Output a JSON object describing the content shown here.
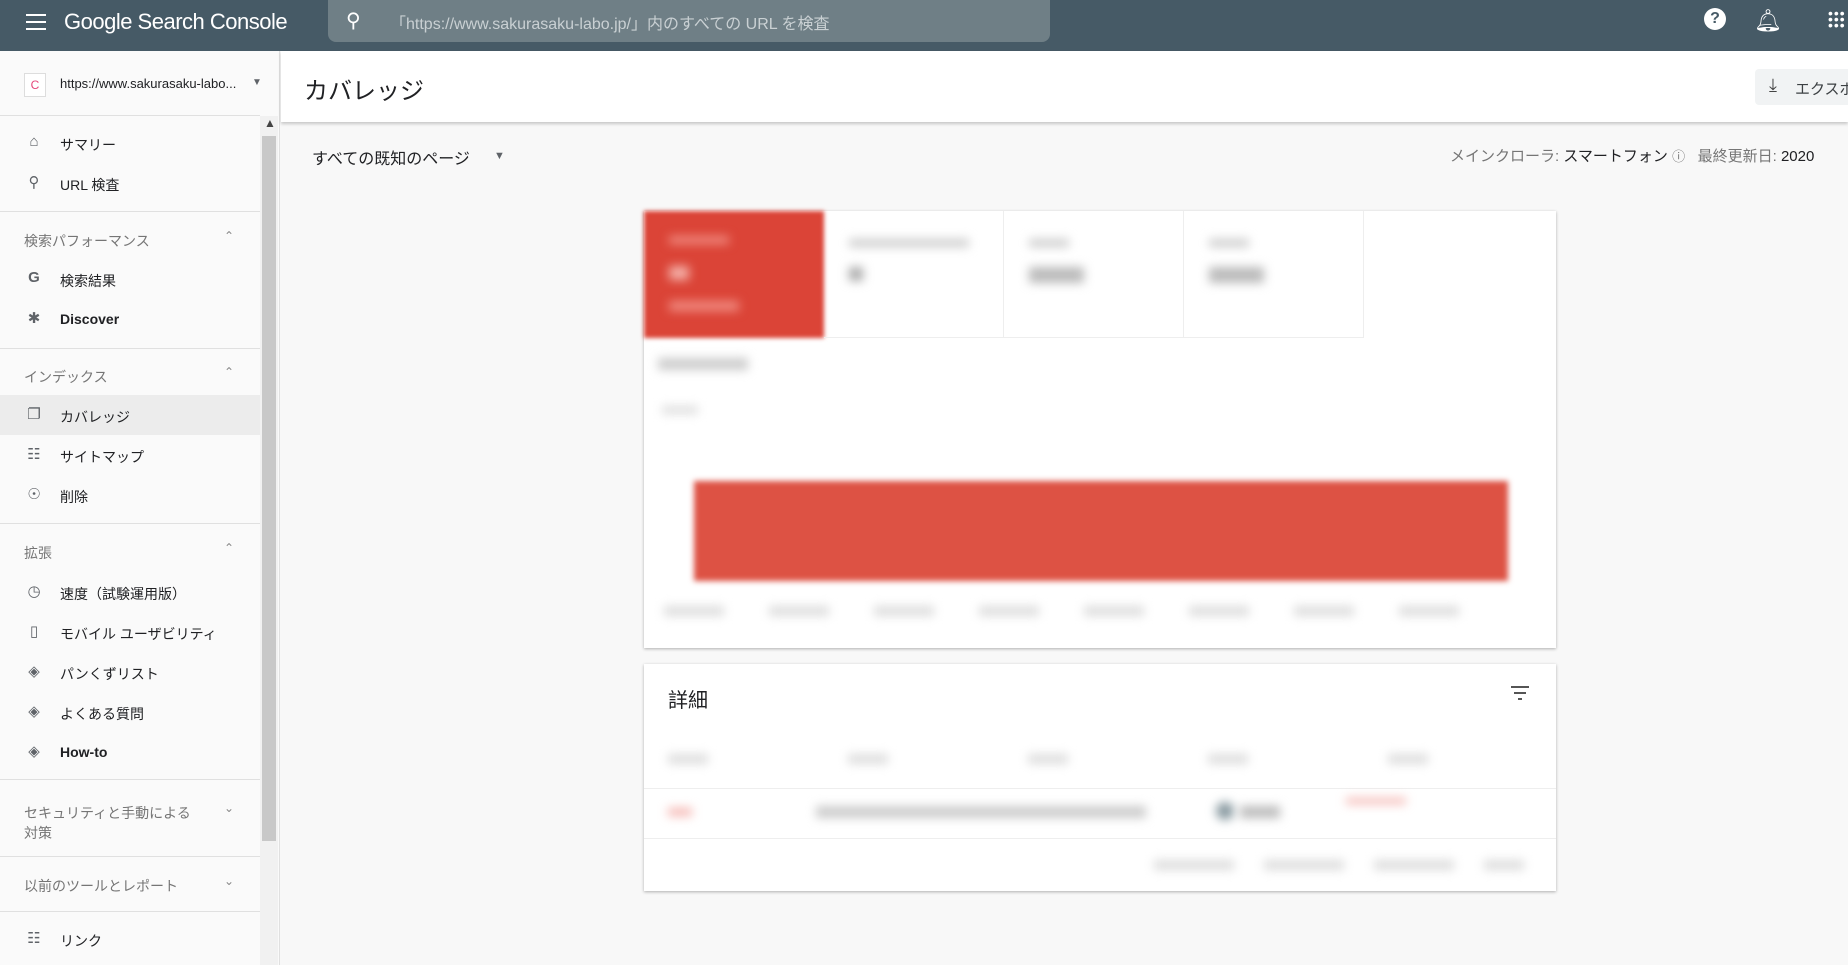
{
  "header": {
    "app_title": "Google Search Console",
    "search_placeholder": "「https://www.sakurasaku-labo.jp/」内のすべての URL を検査",
    "icons": [
      "menu-icon",
      "search-icon",
      "help-icon",
      "bell-icon",
      "apps-icon"
    ],
    "bg_color": "#465a66"
  },
  "property": {
    "url": "https://www.sakurasaku-labo..."
  },
  "sidebar": {
    "items": [
      {
        "label": "サマリー",
        "icon": "home-icon"
      },
      {
        "label": "URL 検査",
        "icon": "search-icon"
      }
    ],
    "sections": [
      {
        "title": "検索パフォーマンス",
        "expanded": true,
        "items": [
          {
            "label": "検索結果",
            "icon": "google-g-icon"
          },
          {
            "label": "Discover",
            "icon": "asterisk-icon"
          }
        ]
      },
      {
        "title": "インデックス",
        "expanded": true,
        "items": [
          {
            "label": "カバレッジ",
            "icon": "copy-icon",
            "selected": true
          },
          {
            "label": "サイトマップ",
            "icon": "sitemap-icon"
          },
          {
            "label": "削除",
            "icon": "eye-off-icon"
          }
        ]
      },
      {
        "title": "拡張",
        "expanded": true,
        "items": [
          {
            "label": "速度（試験運用版）",
            "icon": "speed-icon"
          },
          {
            "label": "モバイル ユーザビリティ",
            "icon": "phone-icon"
          },
          {
            "label": "パンくずリスト",
            "icon": "layers-icon"
          },
          {
            "label": "よくある質問",
            "icon": "layers-icon"
          },
          {
            "label": "How-to",
            "icon": "layers-icon"
          }
        ]
      },
      {
        "title": "セキュリティと手動による対策",
        "expanded": false
      },
      {
        "title": "以前のツールとレポート",
        "expanded": false
      }
    ],
    "bottom_items": [
      {
        "label": "リンク",
        "icon": "links-icon"
      }
    ]
  },
  "page": {
    "title": "カバレッジ",
    "export_label": "エクスポ",
    "filter_label": "すべての既知のページ",
    "crawler_label": "メインクローラ:",
    "crawler_value": "スマートフォン",
    "last_updated_label": "最終更新日:",
    "last_updated_value": "2020"
  },
  "details": {
    "title": "詳細"
  },
  "colors": {
    "error": "#db4437",
    "selected_bg": "#ececec"
  }
}
